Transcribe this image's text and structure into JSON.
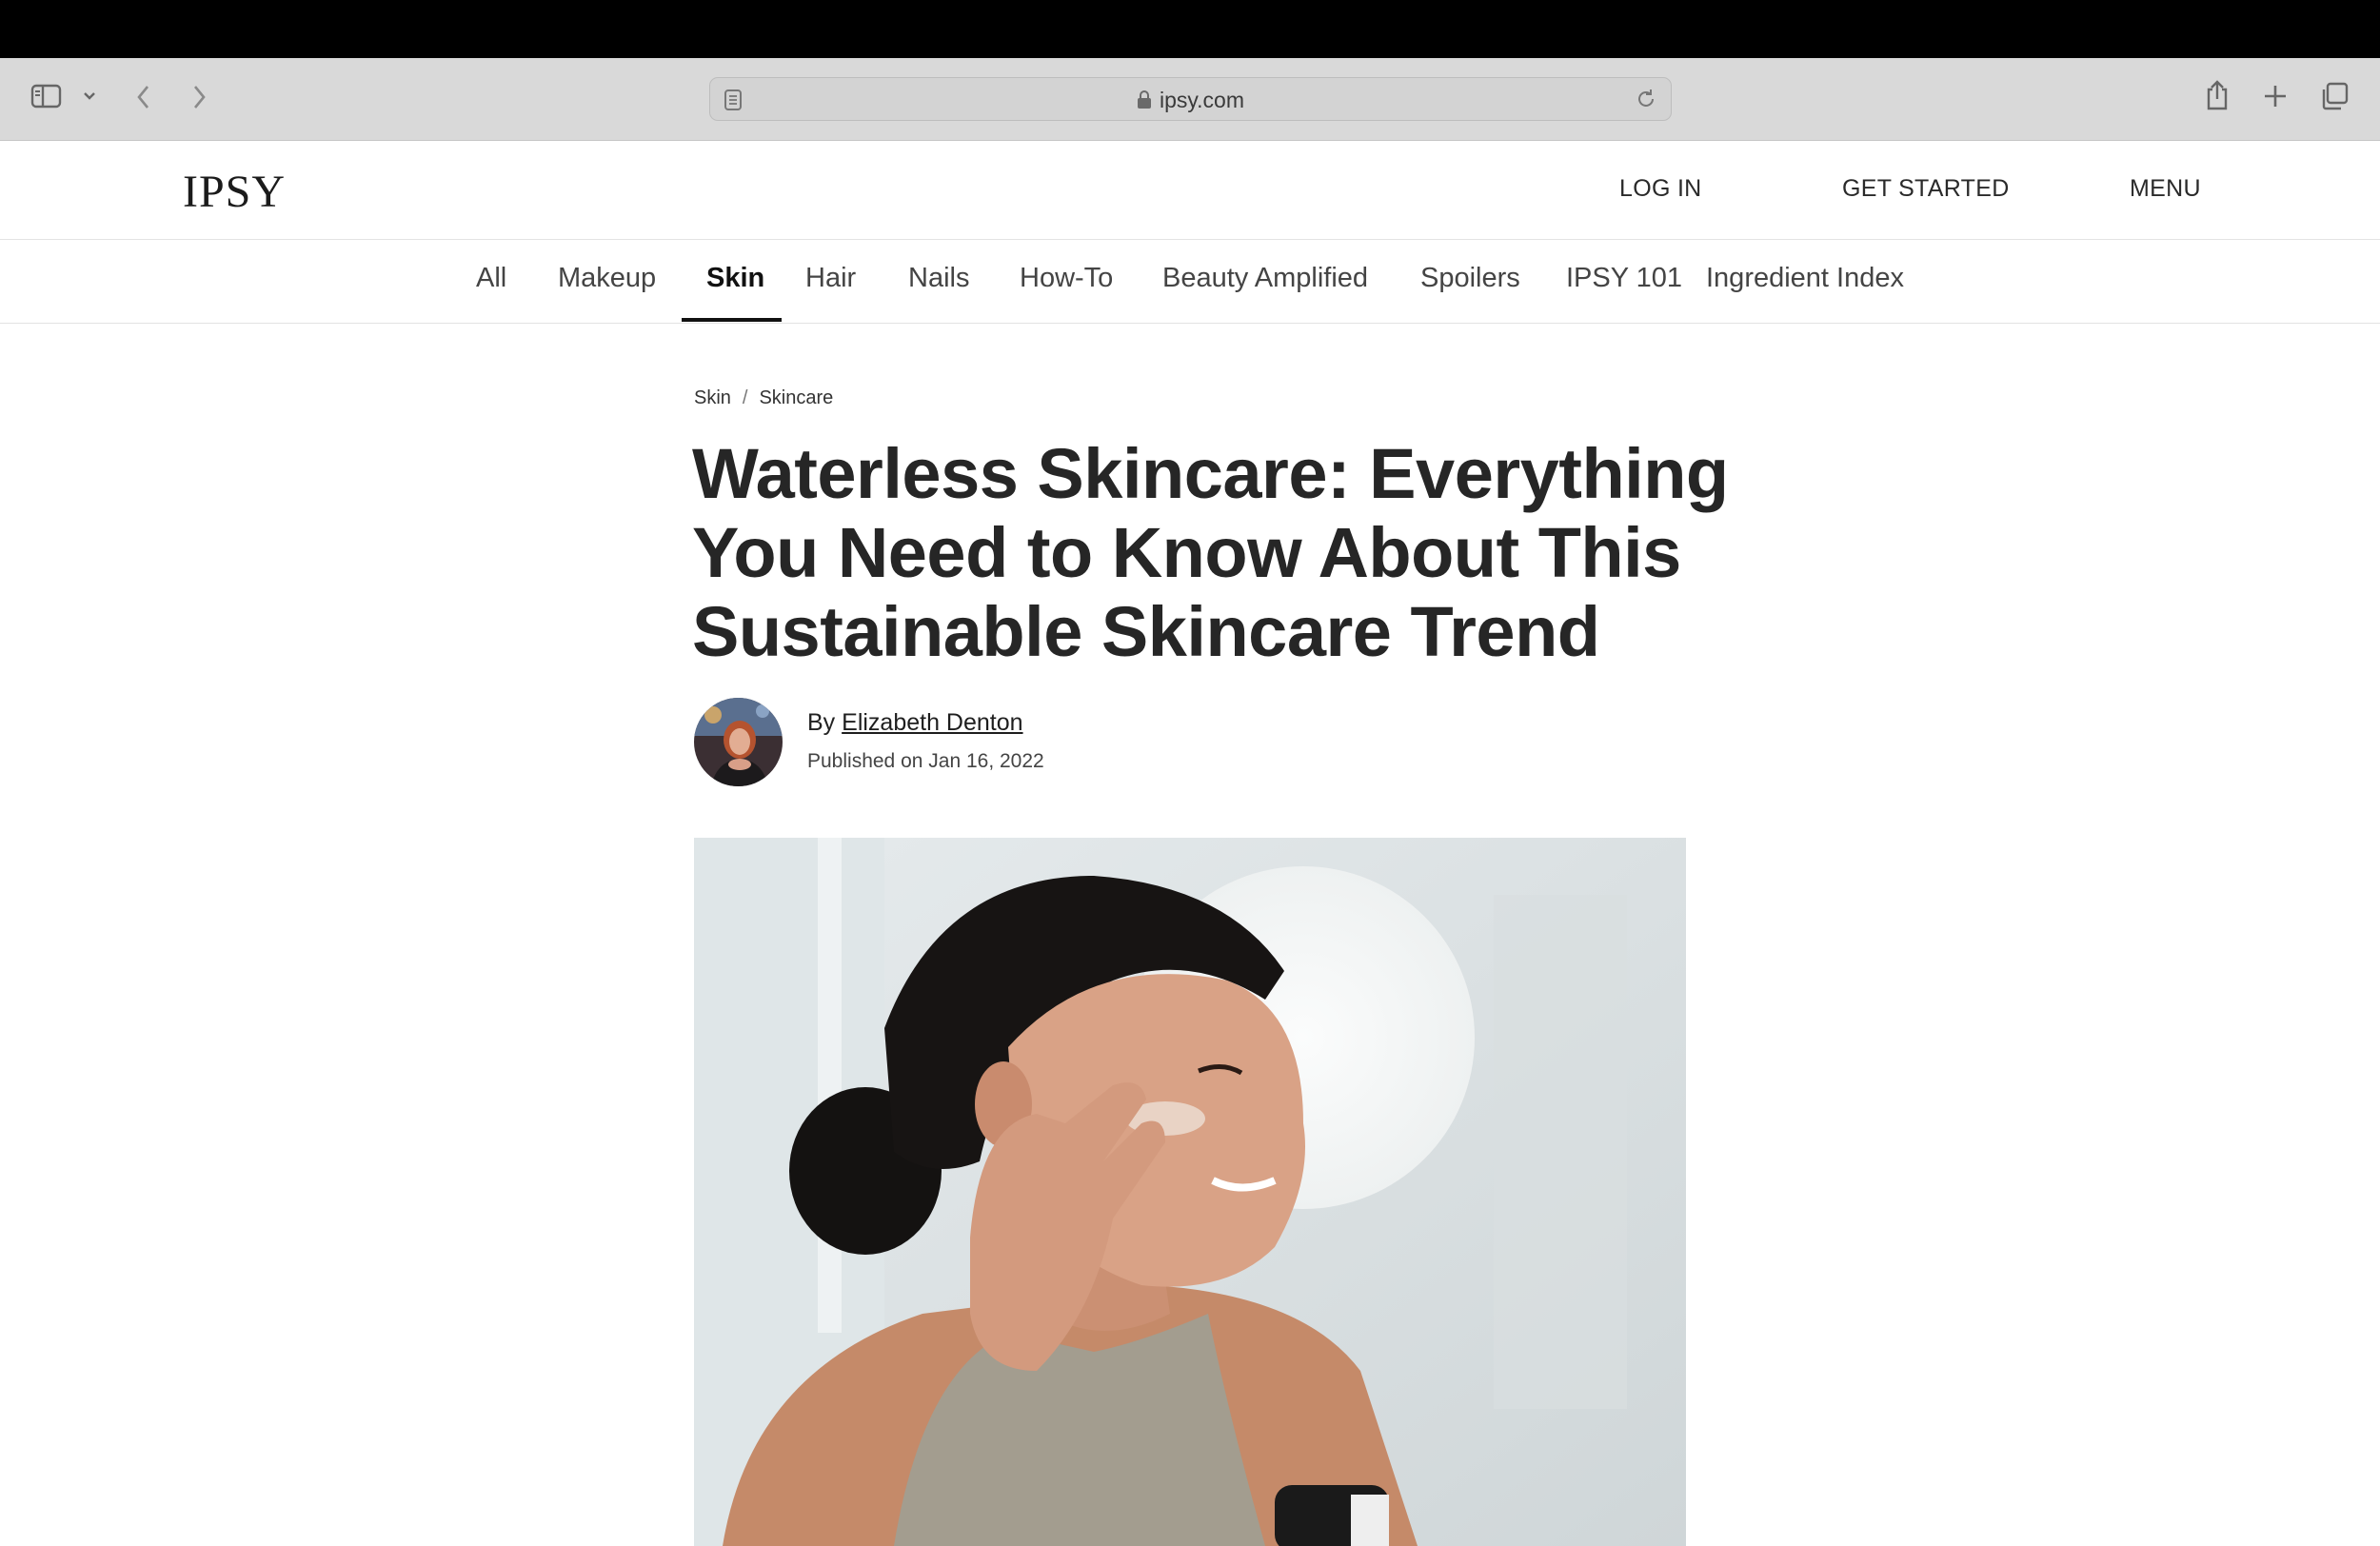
{
  "browser": {
    "url": "ipsy.com"
  },
  "site": {
    "logo": "IPSY",
    "header_links": [
      "LOG IN",
      "GET STARTED",
      "MENU"
    ]
  },
  "nav": {
    "categories": [
      "All",
      "Makeup",
      "Skin",
      "Hair",
      "Nails",
      "How-To",
      "Beauty Amplified",
      "Spoilers",
      "IPSY 101",
      "Ingredient Index"
    ],
    "active": "Skin"
  },
  "article": {
    "breadcrumb": [
      "Skin",
      "Skincare"
    ],
    "breadcrumb_separator": "/",
    "title": "Waterless Skincare: Everything You Need to Know About This Sustainable Skincare Trend",
    "byline_prefix": "By",
    "author": "Elizabeth Denton",
    "published": "Published on Jan 16, 2022"
  },
  "colors": {
    "toolbar": "#d9d9d9",
    "text": "#262626",
    "accent_underline": "#111111"
  }
}
